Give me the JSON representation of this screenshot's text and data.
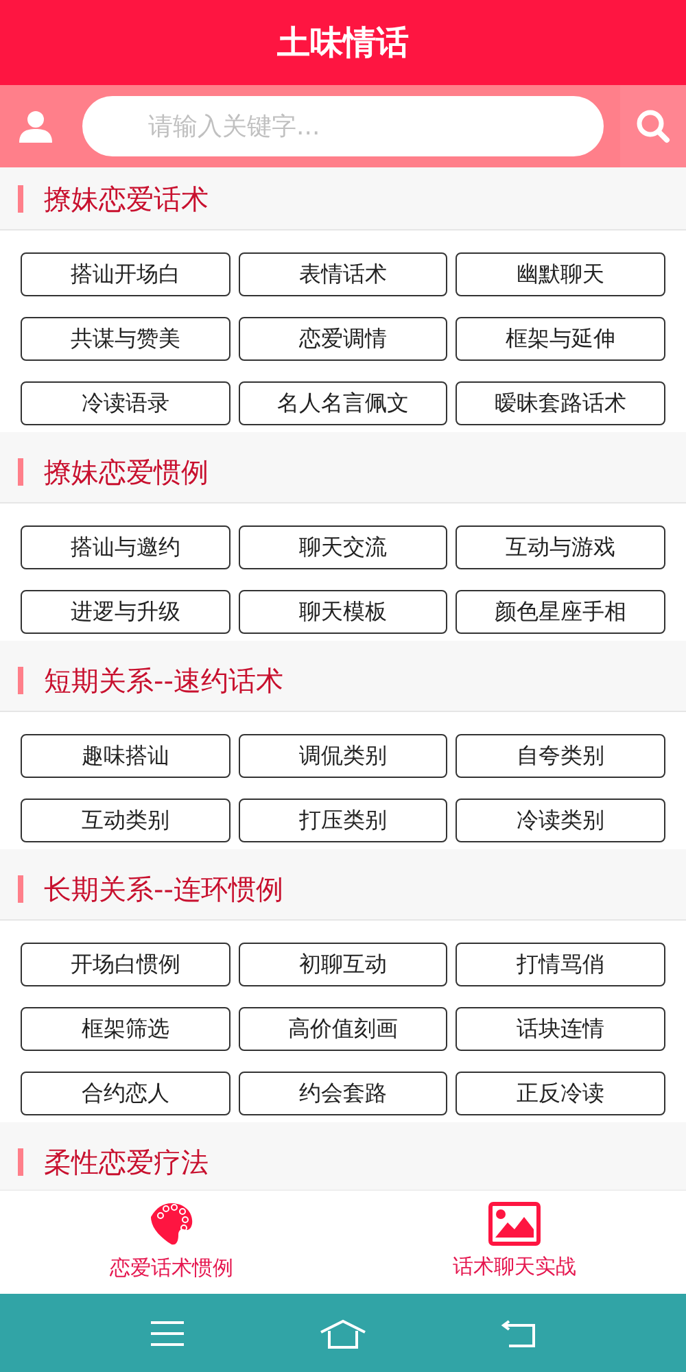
{
  "header": {
    "title": "土味情话"
  },
  "search": {
    "placeholder": "请输入关键字..."
  },
  "sections": [
    {
      "title": "撩妹恋爱话术",
      "items": [
        "搭讪开场白",
        "表情话术",
        "幽默聊天",
        "共谋与赞美",
        "恋爱调情",
        "框架与延伸",
        "冷读语录",
        "名人名言佩文",
        "暧昧套路话术"
      ]
    },
    {
      "title": "撩妹恋爱惯例",
      "items": [
        "搭讪与邀约",
        "聊天交流",
        "互动与游戏",
        "进逻与升级",
        "聊天模板",
        "颜色星座手相"
      ]
    },
    {
      "title": "短期关系--速约话术",
      "items": [
        "趣味搭讪",
        "调侃类别",
        "自夸类别",
        "互动类别",
        "打压类别",
        "冷读类别"
      ]
    },
    {
      "title": "长期关系--连环惯例",
      "items": [
        "开场白惯例",
        "初聊互动",
        "打情骂俏",
        "框架筛选",
        "高价值刻画",
        "话块连情",
        "合约恋人",
        "约会套路",
        "正反冷读"
      ]
    },
    {
      "title": "柔性恋爱疗法"
    }
  ],
  "bottom_tabs": [
    {
      "label": "恋爱话术惯例",
      "kind": "palette"
    },
    {
      "label": "话术聊天实战",
      "kind": "image"
    }
  ]
}
